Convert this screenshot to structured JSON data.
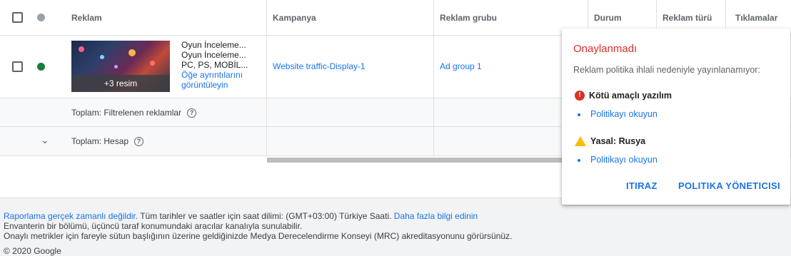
{
  "header": {
    "col_ad": "Reklam",
    "col_campaign": "Kampanya",
    "col_adgroup": "Reklam grubu",
    "col_status": "Durum",
    "col_adtype": "Reklam türü",
    "col_clicks": "Tıklamalar"
  },
  "row1": {
    "thumb_label": "+3 resim",
    "line1": "Oyun İnceleme...",
    "line2": "Oyun İnceleme...",
    "line3": "PC, PS, MOBİL...",
    "details_link": "Öğe ayrıntılarını görüntüleyin",
    "campaign": "Website traffic-Display-1",
    "adgroup": "Ad group 1",
    "status_color": "#188038"
  },
  "row2": {
    "label": "Toplam: Filtrelenen reklamlar"
  },
  "row3": {
    "label": "Toplam: Hesap"
  },
  "footer": {
    "link1": "Raporlama gerçek zamanlı değildir.",
    "text1": " Tüm tarihler ve saatler için saat dilimi: (GMT+03:00) Türkiye Saati. ",
    "link2": "Daha fazla bilgi edinin",
    "line2": "Envanterin bir bölümü, üçüncü taraf konumundaki aracılar kanalıyla sunulabilir.",
    "line3": "Onaylı metrikler için fareyle sütun başlığının üzerine geldiğinizde Medya Derecelendirme Konseyi (MRC) akreditasyonunu görürsünüz.",
    "copyright": "© 2020 Google"
  },
  "popup": {
    "title": "Onaylanmadı",
    "subtitle": "Reklam politika ihlali nedeniyle yayınlanamıyor:",
    "issue1": "Kötü amaçlı yazılım",
    "issue1_link": "Politikayı okuyun",
    "issue2": "Yasal: Rusya",
    "issue2_link": "Politikayı okuyun",
    "btn_appeal": "ITIRAZ",
    "btn_manager": "POLITIKA YÖNETICISI"
  }
}
